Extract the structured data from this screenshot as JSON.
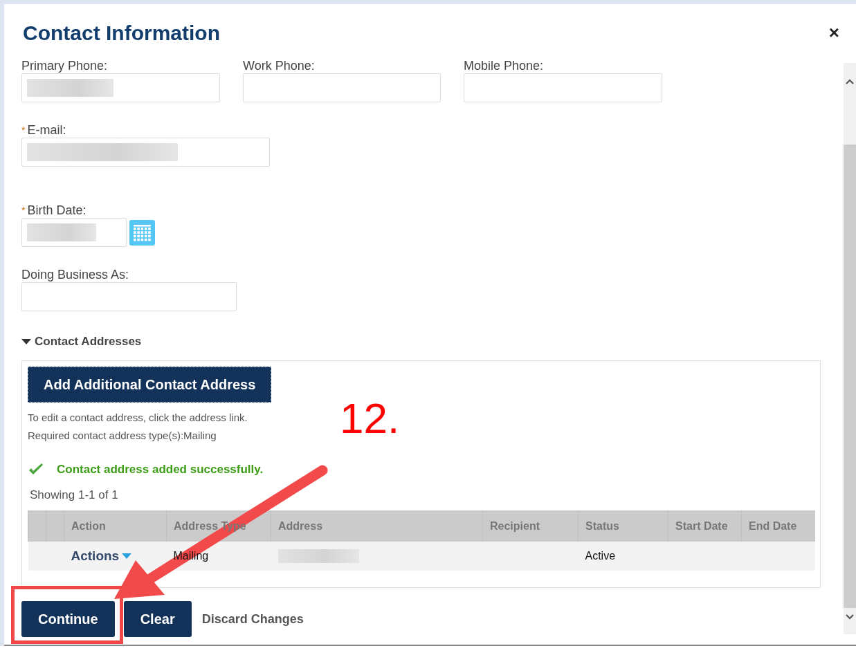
{
  "dialog": {
    "title": "Contact Information",
    "close": "×"
  },
  "field_rows": [
    [
      {
        "label": "Primary Phone:",
        "required": false,
        "redacted": true,
        "kind": "text"
      },
      {
        "label": "Work Phone:",
        "required": false,
        "redacted": false,
        "kind": "text"
      },
      {
        "label": "Mobile Phone:",
        "required": false,
        "redacted": false,
        "kind": "text"
      }
    ],
    [
      {
        "label": "E-mail:",
        "required": true,
        "redacted": true,
        "kind": "text"
      }
    ],
    [
      {
        "label": "Birth Date:",
        "required": true,
        "redacted": true,
        "kind": "date"
      }
    ],
    [
      {
        "label": "Doing Business As:",
        "required": false,
        "redacted": false,
        "kind": "text"
      }
    ]
  ],
  "required_mark": "*",
  "addresses": {
    "title": "Contact Addresses",
    "expanded": true,
    "add_button": "Add Additional Contact Address",
    "help_lines": [
      "To edit a contact address, click the address link.",
      "Required contact address type(s):Mailing"
    ],
    "success_message": "Contact address added successfully.",
    "showing": "Showing 1-1 of 1",
    "table": {
      "columns": [
        {
          "text": "Action"
        },
        {
          "text": "Address Type"
        },
        {
          "text": "Address"
        },
        {
          "text": "Recipient"
        },
        {
          "text": "Status"
        },
        {
          "text": "Start Date"
        },
        {
          "text": "End Date"
        }
      ],
      "rows": [
        {
          "cells": [
            {
              "kind": "menu",
              "text": "Actions"
            },
            {
              "kind": "text",
              "text": "Mailing"
            },
            {
              "kind": "redacted"
            },
            {
              "kind": "empty"
            },
            {
              "kind": "text",
              "text": "Active"
            },
            {
              "kind": "empty"
            },
            {
              "kind": "empty"
            }
          ]
        }
      ]
    }
  },
  "buttons": [
    {
      "label": "Continue",
      "kind": "primary",
      "highlighted": true
    },
    {
      "label": "Clear",
      "kind": "primary",
      "highlighted": false
    },
    {
      "label": "Discard Changes",
      "kind": "link",
      "highlighted": false
    }
  ],
  "annotation": {
    "step_label": "12.",
    "arrow": true
  }
}
